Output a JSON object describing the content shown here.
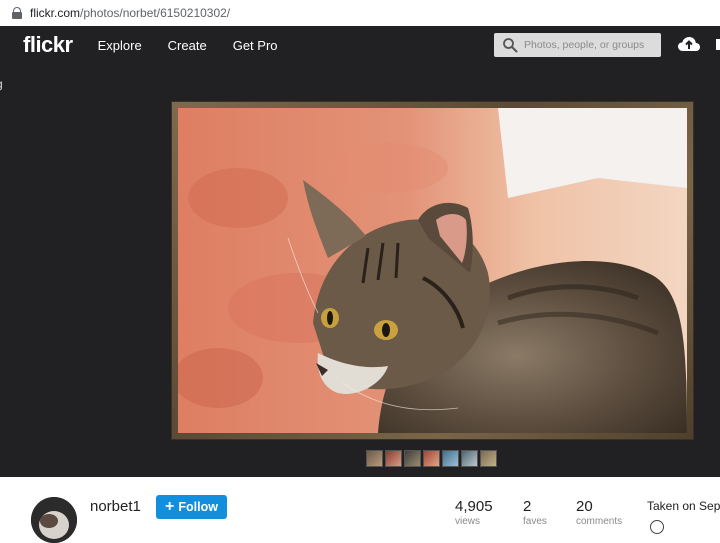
{
  "browser": {
    "url_domain": "flickr.com",
    "url_path": "/photos/norbet/6150210302/"
  },
  "header": {
    "logo": "flickr",
    "nav": [
      "Explore",
      "Create",
      "Get Pro"
    ],
    "search_placeholder": "Photos, people, or groups",
    "icons": [
      "search-icon",
      "upload-cloud-icon"
    ]
  },
  "stage": {
    "side_text": "g",
    "photo_subject": "cat",
    "filmstrip_count": 7
  },
  "owner": {
    "username": "norbet1",
    "follow_label": "Follow"
  },
  "stats": [
    {
      "value": "4,905",
      "label": "views"
    },
    {
      "value": "2",
      "label": "faves"
    },
    {
      "value": "20",
      "label": "comments"
    }
  ],
  "taken_on": "Taken on Sep",
  "colors": {
    "header_bg": "#212124",
    "follow_blue": "#128fdc"
  }
}
